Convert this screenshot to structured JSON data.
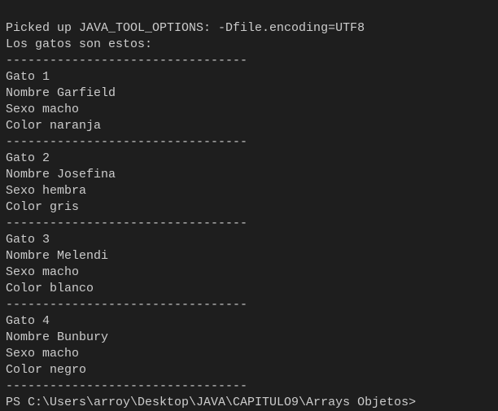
{
  "terminal": {
    "lines": [
      "Picked up JAVA_TOOL_OPTIONS: -Dfile.encoding=UTF8",
      "Los gatos son estos:",
      "---------------------------------",
      "Gato 1",
      "Nombre Garfield",
      "Sexo macho",
      "Color naranja",
      "---------------------------------",
      "Gato 2",
      "Nombre Josefina",
      "Sexo hembra",
      "Color gris",
      "---------------------------------",
      "Gato 3",
      "Nombre Melendi",
      "Sexo macho",
      "Color blanco",
      "---------------------------------",
      "Gato 4",
      "Nombre Bunbury",
      "Sexo macho",
      "Color negro",
      "---------------------------------"
    ],
    "prompt": "PS C:\\Users\\arroy\\Desktop\\JAVA\\CAPITULO9\\Arrays Objetos>"
  }
}
